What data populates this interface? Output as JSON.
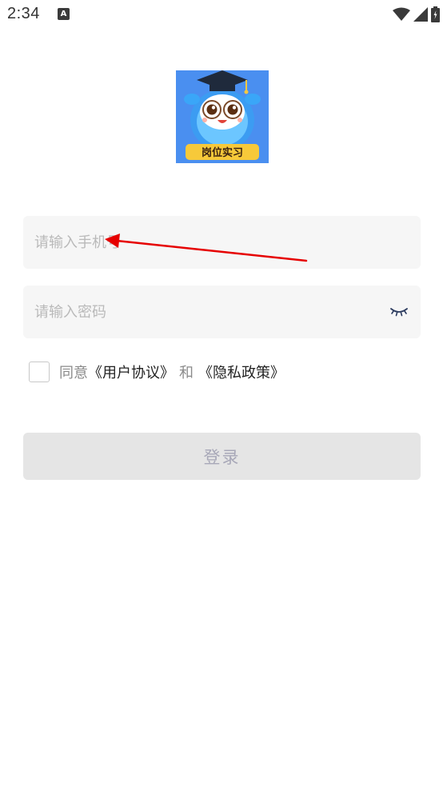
{
  "status_bar": {
    "time": "2:34",
    "notification_icon": "a-icon",
    "icons": [
      "wifi-icon",
      "signal-icon",
      "battery-icon"
    ]
  },
  "logo": {
    "text": "岗位实习"
  },
  "form": {
    "phone_placeholder": "请输入手机号",
    "phone_value": "",
    "password_placeholder": "请输入密码",
    "password_value": "",
    "password_toggle_icon": "eye-closed-icon"
  },
  "agreement": {
    "agree_label": "同意",
    "user_agreement_link": "《用户协议》",
    "and_label": "和",
    "privacy_policy_link": "《隐私政策》",
    "checked": false
  },
  "login_button": {
    "label": "登录"
  },
  "colors": {
    "field_bg": "#f6f6f6",
    "button_bg": "#e5e5e5",
    "button_text": "#a8a8b8",
    "annotation_arrow": "#e60000",
    "logo_bg": "#4a8ff0"
  }
}
